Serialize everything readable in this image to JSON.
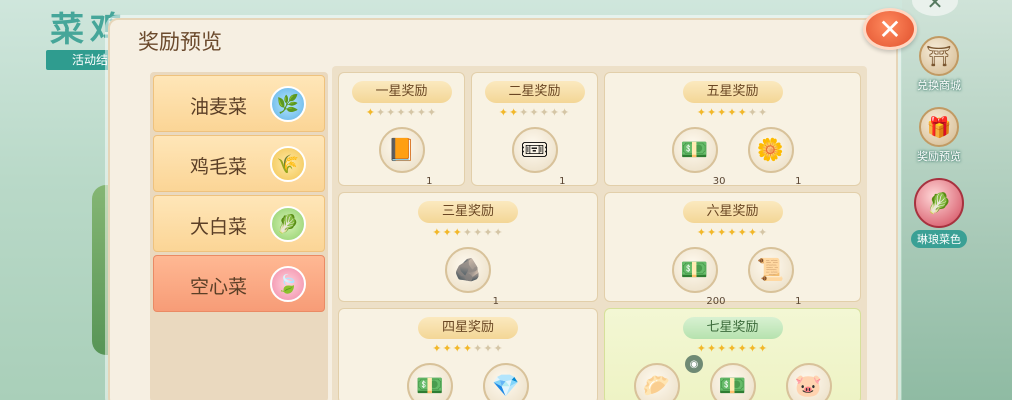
{
  "background": {
    "title": "菜鸡",
    "subtitle": "活动结"
  },
  "side_menu": [
    {
      "label": "兑换商城",
      "icon": "pagoda-icon",
      "glyph": "⛩"
    },
    {
      "label": "奖励预览",
      "icon": "gift-box-icon",
      "glyph": "🎁"
    },
    {
      "label": "琳琅菜色",
      "icon": "vegetable-bag-icon",
      "glyph": "🥬"
    }
  ],
  "dialog": {
    "title": "奖励预览",
    "close_glyph": "✕"
  },
  "tabs": [
    {
      "label": "油麦菜",
      "icon": "lettuce-icon",
      "glyph": "🌿",
      "active": false
    },
    {
      "label": "鸡毛菜",
      "icon": "greens-icon",
      "glyph": "🌾",
      "active": false
    },
    {
      "label": "大白菜",
      "icon": "cabbage-icon",
      "glyph": "🥬",
      "active": false
    },
    {
      "label": "空心菜",
      "icon": "water-spinach-icon",
      "glyph": "🍃",
      "active": true
    }
  ],
  "rewards": [
    {
      "title": "一星奖励",
      "stars": 1,
      "items": [
        {
          "icon": "book-icon",
          "glyph": "📙",
          "count": "1"
        }
      ]
    },
    {
      "title": "二星奖励",
      "stars": 2,
      "items": [
        {
          "icon": "purple-ticket-icon",
          "glyph": "🎟",
          "count": "1"
        }
      ]
    },
    {
      "title": "五星奖励",
      "stars": 5,
      "items": [
        {
          "icon": "green-coupon-icon",
          "glyph": "💵",
          "count": "30"
        },
        {
          "icon": "flower-icon",
          "glyph": "🌼",
          "count": "1"
        }
      ]
    },
    {
      "title": "三星奖励",
      "stars": 3,
      "items": [
        {
          "icon": "stone-icon",
          "glyph": "🪨",
          "count": "1"
        }
      ]
    },
    {
      "title": "六星奖励",
      "stars": 6,
      "items": [
        {
          "icon": "green-coupon-icon",
          "glyph": "💵",
          "count": "200"
        },
        {
          "icon": "scroll-icon",
          "glyph": "📜",
          "count": "1"
        }
      ]
    },
    {
      "title": "四星奖励",
      "stars": 4,
      "items": [
        {
          "icon": "green-coupon-icon",
          "glyph": "💵",
          "count": ""
        },
        {
          "icon": "crystal-icon",
          "glyph": "💎",
          "count": ""
        }
      ]
    },
    {
      "title": "七星奖励",
      "stars": 7,
      "items": [
        {
          "icon": "dumpling-pet-icon",
          "glyph": "🥟",
          "count": ""
        },
        {
          "icon": "green-coupon-icon",
          "glyph": "💵",
          "count": ""
        },
        {
          "icon": "pig-pet-icon",
          "glyph": "🐷",
          "count": ""
        }
      ]
    }
  ],
  "colors": {
    "accent": "#f79c77",
    "star_on": "#f2b82a",
    "star_off": "#d5c6a6",
    "close_button": "#e0502d"
  }
}
